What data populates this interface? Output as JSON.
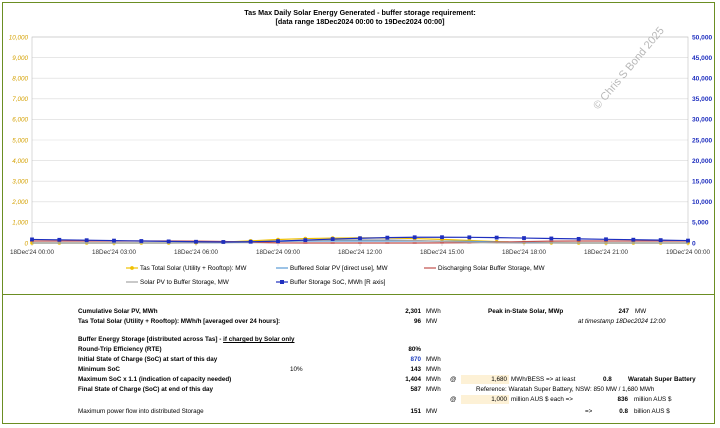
{
  "title_line1": "Tas Max Daily Solar Energy Generated - buffer storage requirement:",
  "title_line2": "[data range  18Dec2024 00:00 to 19Dec2024 00:00]",
  "watermark": "© Chris S Bond  2025",
  "chart_data": {
    "type": "line",
    "x_tick_labels": [
      "18Dec'24 00:00",
      "18Dec'24 03:00",
      "18Dec'24 06:00",
      "18Dec'24 09:00",
      "18Dec'24 12:00",
      "18Dec'24 15:00",
      "18Dec'24 18:00",
      "18Dec'24 21:00",
      "19Dec'24 00:00"
    ],
    "x_hours": [
      0,
      1,
      2,
      3,
      4,
      5,
      6,
      7,
      8,
      9,
      10,
      11,
      12,
      13,
      14,
      15,
      16,
      17,
      18,
      19,
      20,
      21,
      22,
      23,
      24
    ],
    "y_left": {
      "min": 0,
      "max": 10000,
      "ticks": [
        0,
        1000,
        2000,
        3000,
        4000,
        5000,
        6000,
        7000,
        8000,
        9000,
        10000
      ],
      "tick_labels": [
        "0",
        "1,000",
        "2,000",
        "3,000",
        "4,000",
        "5,000",
        "6,000",
        "7,000",
        "8,000",
        "9,000",
        "10,000"
      ]
    },
    "y_right": {
      "min": 0,
      "max": 50000,
      "ticks": [
        0,
        5000,
        10000,
        15000,
        20000,
        25000,
        30000,
        35000,
        40000,
        45000,
        50000
      ],
      "tick_labels": [
        "0",
        "5,000",
        "10,000",
        "15,000",
        "20,000",
        "25,000",
        "30,000",
        "35,000",
        "40,000",
        "45,000",
        "50,000"
      ]
    },
    "grid": true,
    "legend_placement": "bottom",
    "series": [
      {
        "name": "Tas Total Solar (Utility + Rooftop): MW",
        "axis": "left",
        "color": "#f0c000",
        "marker": "circle",
        "values": [
          0,
          0,
          0,
          0,
          0,
          0,
          10,
          45,
          105,
          170,
          215,
          240,
          247,
          240,
          215,
          175,
          120,
          65,
          25,
          5,
          0,
          0,
          0,
          0,
          0
        ]
      },
      {
        "name": "Buffered Solar PV [direct use], MW",
        "axis": "left",
        "color": "#5b9bd5",
        "marker": "none",
        "values": [
          0,
          0,
          0,
          0,
          0,
          0,
          5,
          20,
          50,
          80,
          95,
          96,
          96,
          96,
          95,
          90,
          80,
          55,
          25,
          5,
          0,
          0,
          0,
          0,
          0
        ]
      },
      {
        "name": "Discharging Solar Buffer Storage, MW",
        "axis": "left",
        "color": "#c0504d",
        "marker": "dash",
        "values": [
          96,
          96,
          96,
          96,
          96,
          96,
          90,
          75,
          40,
          5,
          0,
          0,
          0,
          0,
          0,
          5,
          15,
          40,
          70,
          90,
          96,
          96,
          96,
          96,
          96
        ]
      },
      {
        "name": "Solar PV to Buffer Storage, MW",
        "axis": "left",
        "color": "#a5a5a5",
        "marker": "none",
        "values": [
          0,
          0,
          0,
          0,
          0,
          0,
          5,
          25,
          55,
          90,
          120,
          144,
          151,
          144,
          120,
          85,
          40,
          10,
          0,
          0,
          0,
          0,
          0,
          0,
          0
        ]
      },
      {
        "name": "Buffer Storage SoC, MWh [R axis]",
        "axis": "right",
        "color": "#1f2fbf",
        "marker": "square",
        "values": [
          870,
          774,
          678,
          582,
          486,
          390,
          300,
          250,
          300,
          450,
          700,
          950,
          1150,
          1300,
          1390,
          1404,
          1380,
          1310,
          1200,
          1100,
          1000,
          900,
          800,
          700,
          587
        ]
      }
    ]
  },
  "table": {
    "r1": {
      "label": "Cumulative Solar PV, MWh",
      "value": "2,301",
      "unit": "MWh",
      "label2": "Peak in-State Solar, MWp",
      "value2": "247",
      "unit2": "MW"
    },
    "r2": {
      "label": "Tas Total Solar (Utility + Rooftop): MWh/h [averaged over 24 hours]:",
      "value": "96",
      "unit": "MW",
      "note": "at timestamp 18Dec2024 12:00"
    },
    "r3": {
      "label": "Buffer Energy Storage [distributed across Tas] - ",
      "label_u": "if charged by Solar only"
    },
    "r4": {
      "label": "Round-Trip Efficiency (RTE)",
      "value": "80%"
    },
    "r5": {
      "label": "Initial State of Charge (SoC) at start of this day",
      "value": "870",
      "unit": "MWh"
    },
    "r6": {
      "label": "Minimum SoC",
      "pct": "10%",
      "value": "143",
      "unit": "MWh"
    },
    "r7": {
      "label": "Maximum SoC x 1.1 (indication of capacity needed)",
      "value": "1,404",
      "unit": "MWh",
      "at": "@",
      "bess": "1,680",
      "bess_text": "MWh/BESS => at least",
      "count": "0.8",
      "ref_name": "Waratah Super Battery"
    },
    "r8": {
      "label": "Final State of Charge (SoC) at end of this day",
      "value": "587",
      "unit": "MWh",
      "reference": "Reference: Waratah Super Battery, NSW: 850 MW / 1,680 MWh"
    },
    "r9": {
      "at": "@",
      "cost": "1,000",
      "cost_text": "million AUS $ each =>",
      "total": "836",
      "total_unit": "million AUS $"
    },
    "r10": {
      "label": "Maximum power flow into distributed Storage",
      "value": "151",
      "unit": "MW",
      "arrow": "=>",
      "billion": "0.8",
      "billion_unit": "billion AUS $"
    }
  }
}
